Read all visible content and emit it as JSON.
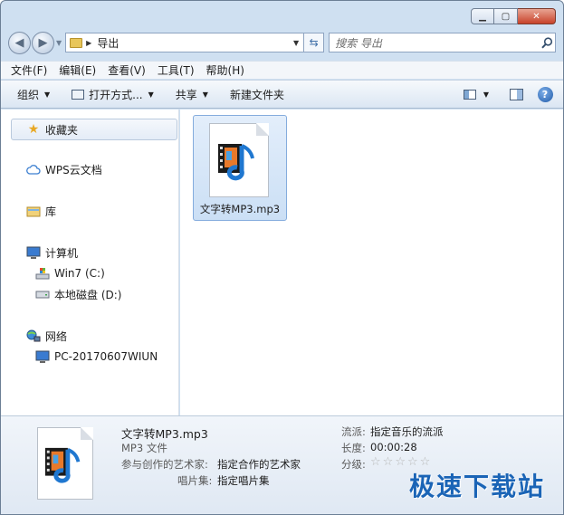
{
  "window": {
    "caption": {
      "minimize": "▁",
      "maximize": "▢",
      "close": "✕"
    }
  },
  "address": {
    "breadcrumb": "导出",
    "search_placeholder": "搜索 导出"
  },
  "menu": [
    "文件(F)",
    "编辑(E)",
    "查看(V)",
    "工具(T)",
    "帮助(H)"
  ],
  "toolbar": {
    "organize": "组织",
    "open_with": "打开方式...",
    "share": "共享",
    "new_folder": "新建文件夹"
  },
  "nav": {
    "favorites": "收藏夹",
    "wps": "WPS云文档",
    "library": "库",
    "computer": "计算机",
    "drive_c": "Win7 (C:)",
    "drive_d": "本地磁盘 (D:)",
    "network": "网络",
    "pc": "PC-20170607WIUN"
  },
  "file": {
    "name": "文字转MP3.mp3"
  },
  "details": {
    "filename": "文字转MP3.mp3",
    "type": "MP3 文件",
    "artist_label": "参与创作的艺术家:",
    "artist_value": "指定合作的艺术家",
    "album_label": "唱片集:",
    "album_value": "指定唱片集",
    "genre_label": "流派:",
    "genre_value": "指定音乐的流派",
    "length_label": "长度:",
    "length_value": "00:00:28",
    "rating_label": "分级:",
    "rating": 0
  },
  "watermark": "极速下载站",
  "colors": {
    "accent": "#1a64b6",
    "selection": "#cbdff5",
    "chrome": "#cfe0f1"
  },
  "icons": [
    "back-icon",
    "forward-icon",
    "folder-icon",
    "refresh-icon",
    "search-icon",
    "organize-icon",
    "view-icon",
    "preview-pane-icon",
    "help-icon",
    "star-icon",
    "cloud-icon",
    "library-icon",
    "computer-icon",
    "drive-icon",
    "network-icon",
    "mp3-file-icon"
  ]
}
